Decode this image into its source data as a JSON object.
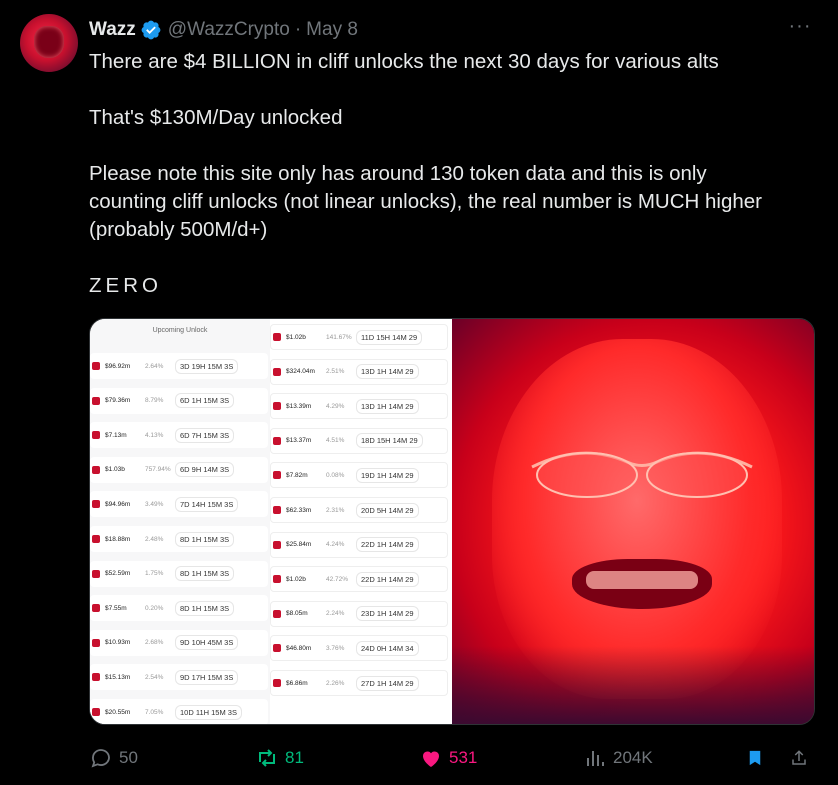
{
  "author": {
    "name": "Wazz",
    "handle": "@WazzCrypto",
    "separator": "·",
    "date": "May 8",
    "verified": true
  },
  "tweet": {
    "paragraphs": [
      "There are $4 BILLION in cliff unlocks the next 30 days for various alts",
      "That's $130M/Day unlocked",
      "Please note this site only has around 130 token data and  this is only counting cliff unlocks (not linear unlocks), the real number is MUCH higher (probably 500M/d+)",
      "ZERO"
    ]
  },
  "more_menu": {
    "icon": "more-horizontal-icon",
    "label": "···"
  },
  "media": {
    "left": {
      "header": "Upcoming Unlock",
      "col_a": [
        {
          "amount": "$96.92m",
          "pct": "2.64%",
          "countdown": "3D 19H 15M 3S"
        },
        {
          "amount": "$79.36m",
          "pct": "8.79%",
          "countdown": "6D 1H 15M 3S"
        },
        {
          "amount": "$7.13m",
          "pct": "4.13%",
          "countdown": "6D 7H 15M 3S"
        },
        {
          "amount": "$1.03b",
          "pct": "757.94%",
          "countdown": "6D 9H 14M 3S"
        },
        {
          "amount": "$94.96m",
          "pct": "3.49%",
          "countdown": "7D 14H 15M 3S"
        },
        {
          "amount": "$18.88m",
          "pct": "2.48%",
          "countdown": "8D 1H 15M 3S"
        },
        {
          "amount": "$52.59m",
          "pct": "1.75%",
          "countdown": "8D 1H 15M 3S"
        },
        {
          "amount": "$7.55m",
          "pct": "0.20%",
          "countdown": "8D 1H 15M 3S"
        },
        {
          "amount": "$10.93m",
          "pct": "2.68%",
          "countdown": "9D 10H 45M 3S"
        },
        {
          "amount": "$15.13m",
          "pct": "2.54%",
          "countdown": "9D 17H 15M 3S"
        },
        {
          "amount": "$20.55m",
          "pct": "7.05%",
          "countdown": "10D 11H 15M 3S"
        }
      ],
      "col_b": [
        {
          "amount": "$1.02b",
          "pct": "141.67%",
          "countdown": "11D 15H 14M 29"
        },
        {
          "amount": "$324.04m",
          "pct": "2.51%",
          "countdown": "13D 1H 14M 29"
        },
        {
          "amount": "$13.39m",
          "pct": "4.29%",
          "countdown": "13D 1H 14M 29"
        },
        {
          "amount": "$13.37m",
          "pct": "4.51%",
          "countdown": "18D 15H 14M 29"
        },
        {
          "amount": "$7.82m",
          "pct": "0.08%",
          "countdown": "19D 1H 14M 29"
        },
        {
          "amount": "$62.33m",
          "pct": "2.31%",
          "countdown": "20D 5H 14M 29"
        },
        {
          "amount": "$25.84m",
          "pct": "4.24%",
          "countdown": "22D 1H 14M 29"
        },
        {
          "amount": "$1.02b",
          "pct": "42.72%",
          "countdown": "22D 1H 14M 29"
        },
        {
          "amount": "$8.05m",
          "pct": "2.24%",
          "countdown": "23D 1H 14M 29"
        },
        {
          "amount": "$46.80m",
          "pct": "3.76%",
          "countdown": "24D 0H 14M 34"
        },
        {
          "amount": "$6.86m",
          "pct": "2.26%",
          "countdown": "27D 1H 14M 29"
        }
      ]
    }
  },
  "actions": {
    "replies": "50",
    "reposts": "81",
    "likes": "531",
    "views": "204K"
  },
  "colors": {
    "background": "#000000",
    "text": "#e7e9ea",
    "muted": "#71767b",
    "verified": "#1d9bf0",
    "repost": "#00ba7c",
    "like": "#f91880",
    "bookmark": "#1d9bf0"
  }
}
